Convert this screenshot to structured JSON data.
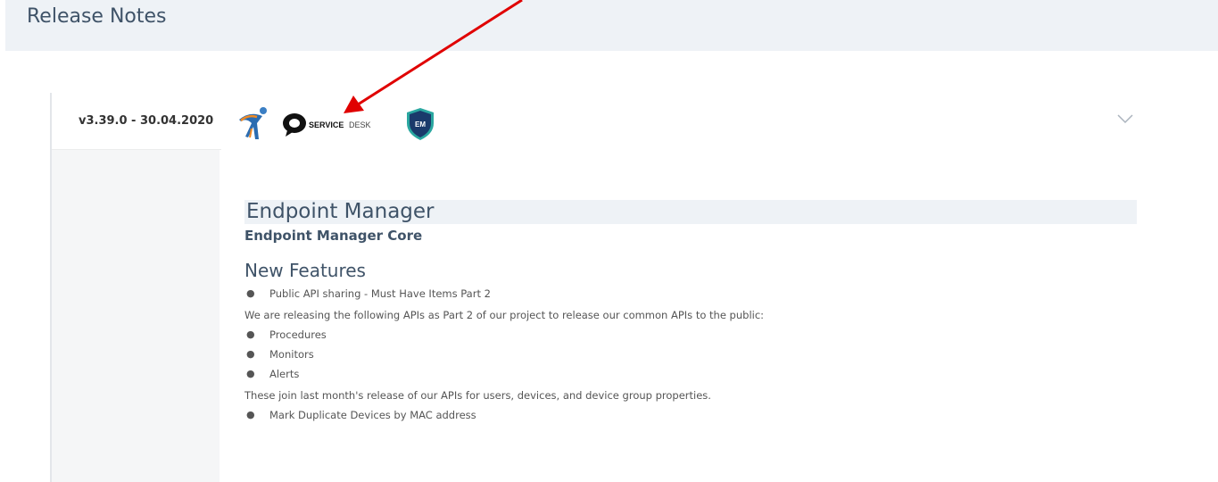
{
  "header": {
    "title": "Release Notes"
  },
  "release": {
    "version": "v3.39.0 - 30.04.2020",
    "logos": [
      {
        "name": "person-runner-logo"
      },
      {
        "name": "servicedesk-logo",
        "text_bold": "SERVICE",
        "text_light": "DESK"
      },
      {
        "name": "em-shield-logo",
        "text": "EM"
      }
    ],
    "expand_icon": "chevron-down-icon"
  },
  "content": {
    "product_title": "Endpoint Manager",
    "product_subtitle": "Endpoint Manager Core",
    "section_title": "New Features",
    "items": [
      {
        "type": "bullet",
        "text": "Public API sharing - Must Have Items Part 2"
      },
      {
        "type": "para",
        "text": "We are releasing the following APIs as Part 2 of our project to release our common APIs to the public:"
      },
      {
        "type": "bullet",
        "text": "Procedures"
      },
      {
        "type": "bullet",
        "text": "Monitors"
      },
      {
        "type": "bullet",
        "text": "Alerts"
      },
      {
        "type": "para",
        "text": "These join last month's release of our APIs for users, devices, and device group properties."
      },
      {
        "type": "bullet",
        "text": "Mark Duplicate Devices by MAC address"
      }
    ]
  },
  "colors": {
    "accent": "#3f5368",
    "header_bg": "#eef2f6",
    "arrow": "#e00000"
  }
}
